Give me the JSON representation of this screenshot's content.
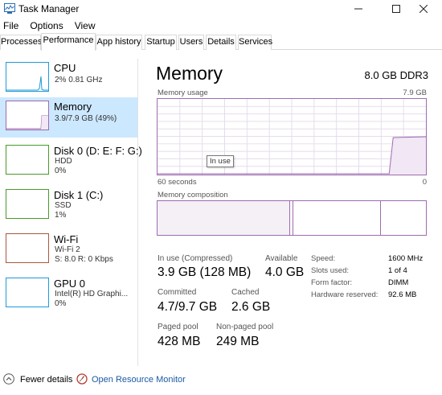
{
  "window": {
    "title": "Task Manager"
  },
  "menu": [
    "File",
    "Options",
    "View"
  ],
  "tabs": [
    "Processes",
    "Performance",
    "App history",
    "Startup",
    "Users",
    "Details",
    "Services"
  ],
  "active_tab": "Performance",
  "resources": [
    {
      "name": "CPU",
      "line1": "2%  0.81 GHz",
      "line2": "",
      "color": "#1f9ad6",
      "selected": false
    },
    {
      "name": "Memory",
      "line1": "3.9/7.9 GB (49%)",
      "line2": "",
      "color": "#9e6bb0",
      "selected": true
    },
    {
      "name": "Disk 0 (D: E: F: G:)",
      "line1": "HDD",
      "line2": "0%",
      "color": "#4a9a2a",
      "selected": false
    },
    {
      "name": "Disk 1 (C:)",
      "line1": "SSD",
      "line2": "1%",
      "color": "#4a9a2a",
      "selected": false
    },
    {
      "name": "Wi-Fi",
      "line1": "Wi-Fi 2",
      "line2": "S: 8.0  R: 0 Kbps",
      "color": "#a8593c",
      "selected": false
    },
    {
      "name": "GPU 0",
      "line1": "Intel(R) HD Graphi...",
      "line2": "0%",
      "color": "#1f9ad6",
      "selected": false
    }
  ],
  "memory": {
    "title": "Memory",
    "spec": "8.0 GB DDR3",
    "usage_label": "Memory usage",
    "usage_max": "7.9 GB",
    "axis_left": "60 seconds",
    "axis_right": "0",
    "tooltip": "In use",
    "composition_label": "Memory composition",
    "in_use_compressed_label": "In use (Compressed)",
    "in_use_compressed_value": "3.9 GB (128 MB)",
    "available_label": "Available",
    "available_value": "4.0 GB",
    "committed_label": "Committed",
    "committed_value": "4.7/9.7 GB",
    "cached_label": "Cached",
    "cached_value": "2.6 GB",
    "paged_pool_label": "Paged pool",
    "paged_pool_value": "428 MB",
    "nonpaged_pool_label": "Non-paged pool",
    "nonpaged_pool_value": "249 MB",
    "speed_label": "Speed:",
    "speed_value": "1600 MHz",
    "slots_label": "Slots used:",
    "slots_value": "1 of 4",
    "form_factor_label": "Form factor:",
    "form_factor_value": "DIMM",
    "hw_reserved_label": "Hardware reserved:",
    "hw_reserved_value": "92.6 MB"
  },
  "bottom": {
    "fewer_details": "Fewer details",
    "open_monitor": "Open Resource Monitor"
  },
  "colors": {
    "accent_memory": "#9e6bb0",
    "selected_bg": "#cce8ff",
    "link": "#1a5aa6"
  }
}
